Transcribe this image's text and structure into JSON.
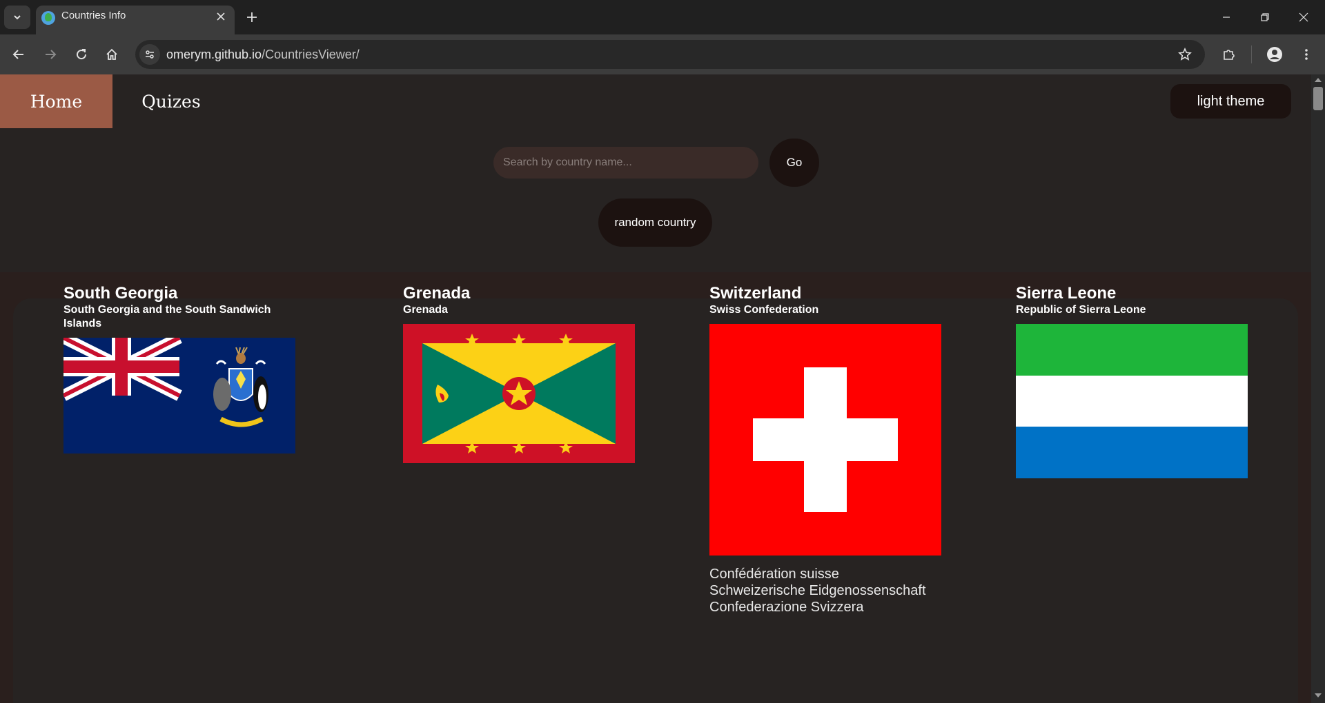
{
  "browser": {
    "tab_title": "Countries Info",
    "url_domain": "omerym.github.io",
    "url_path": "/CountriesViewer/"
  },
  "nav": {
    "home_label": "Home",
    "quizes_label": "Quizes",
    "theme_label": "light theme"
  },
  "search": {
    "placeholder": "Search by country name...",
    "value": "",
    "go_label": "Go",
    "random_label": "random country"
  },
  "colors": {
    "page_bg": "#272322",
    "accent_home": "#9b5a45",
    "button_bg": "#1c1210"
  },
  "countries": [
    {
      "name": "South Georgia",
      "official": "South Georgia and the South Sandwich Islands",
      "flag": "south-georgia-flag",
      "native_names": []
    },
    {
      "name": "Grenada",
      "official": "Grenada",
      "flag": "grenada-flag",
      "native_names": []
    },
    {
      "name": "Switzerland",
      "official": "Swiss Confederation",
      "flag": "switzerland-flag",
      "native_names": [
        "Confédération suisse",
        "Schweizerische Eidgenossenschaft",
        "Confederazione Svizzera"
      ]
    },
    {
      "name": "Sierra Leone",
      "official": "Republic of Sierra Leone",
      "flag": "sierra-leone-flag",
      "native_names": []
    }
  ]
}
